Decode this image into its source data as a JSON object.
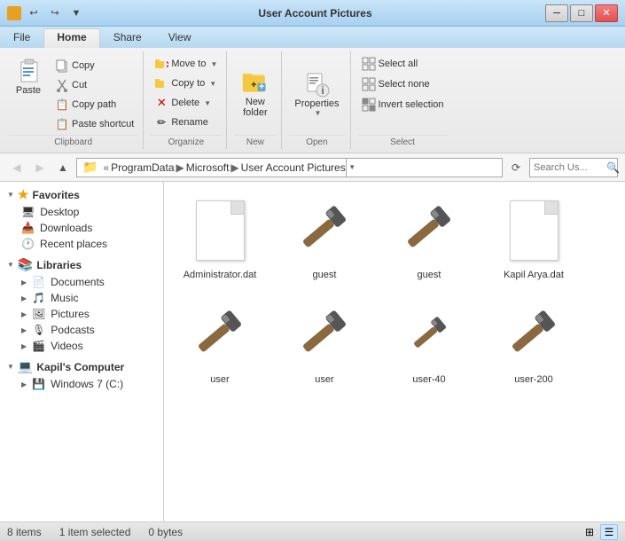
{
  "window": {
    "title": "User Account Pictures",
    "qat_buttons": [
      "↩",
      "↪",
      "▼"
    ]
  },
  "title_bar": {
    "controls": {
      "minimize": "─",
      "maximize": "□",
      "close": "✕"
    }
  },
  "ribbon": {
    "tabs": [
      "File",
      "Home",
      "Share",
      "View"
    ],
    "active_tab": "Home",
    "groups": {
      "clipboard": {
        "label": "Clipboard",
        "copy_label": "Copy",
        "paste_label": "Paste",
        "cut_label": "Cut",
        "copy_path_label": "Copy path",
        "paste_shortcut_label": "Paste shortcut"
      },
      "organize": {
        "label": "Organize",
        "move_to_label": "Move to",
        "copy_to_label": "Copy to",
        "delete_label": "Delete",
        "rename_label": "Rename"
      },
      "new": {
        "label": "New",
        "new_folder_label": "New\nfolder"
      },
      "open": {
        "label": "Open",
        "properties_label": "Properties"
      },
      "select": {
        "label": "Select",
        "select_all_label": "Select all",
        "select_none_label": "Select none",
        "invert_label": "Invert selection"
      }
    }
  },
  "address_bar": {
    "path_parts": [
      "ProgramData",
      "Microsoft",
      "User Account Pictures"
    ],
    "search_placeholder": "Search Us...",
    "refresh_icon": "⟳"
  },
  "sidebar": {
    "favorites": {
      "header": "Favorites",
      "items": [
        {
          "label": "Desktop",
          "id": "desktop"
        },
        {
          "label": "Downloads",
          "id": "downloads"
        },
        {
          "label": "Recent places",
          "id": "recent"
        }
      ]
    },
    "libraries": {
      "header": "Libraries",
      "items": [
        {
          "label": "Documents",
          "id": "documents"
        },
        {
          "label": "Music",
          "id": "music"
        },
        {
          "label": "Pictures",
          "id": "pictures"
        },
        {
          "label": "Podcasts",
          "id": "podcasts"
        },
        {
          "label": "Videos",
          "id": "videos"
        }
      ]
    },
    "computer": {
      "header": "Kapil's Computer",
      "items": [
        {
          "label": "Windows 7 (C:)",
          "id": "c_drive"
        }
      ]
    }
  },
  "files": [
    {
      "name": "Administrator.dat",
      "type": "document",
      "id": "admin_dat"
    },
    {
      "name": "guest",
      "type": "hammer",
      "id": "guest1"
    },
    {
      "name": "guest",
      "type": "hammer",
      "id": "guest2"
    },
    {
      "name": "Kapil Arya.dat",
      "type": "document",
      "id": "kapil_dat"
    },
    {
      "name": "user",
      "type": "hammer",
      "id": "user1"
    },
    {
      "name": "user",
      "type": "hammer",
      "id": "user2"
    },
    {
      "name": "user-40",
      "type": "hammer_small",
      "id": "user40"
    },
    {
      "name": "user-200",
      "type": "hammer",
      "id": "user200"
    }
  ],
  "status": {
    "items_count": "8 items",
    "selected": "1 item selected",
    "size": "0 bytes"
  }
}
